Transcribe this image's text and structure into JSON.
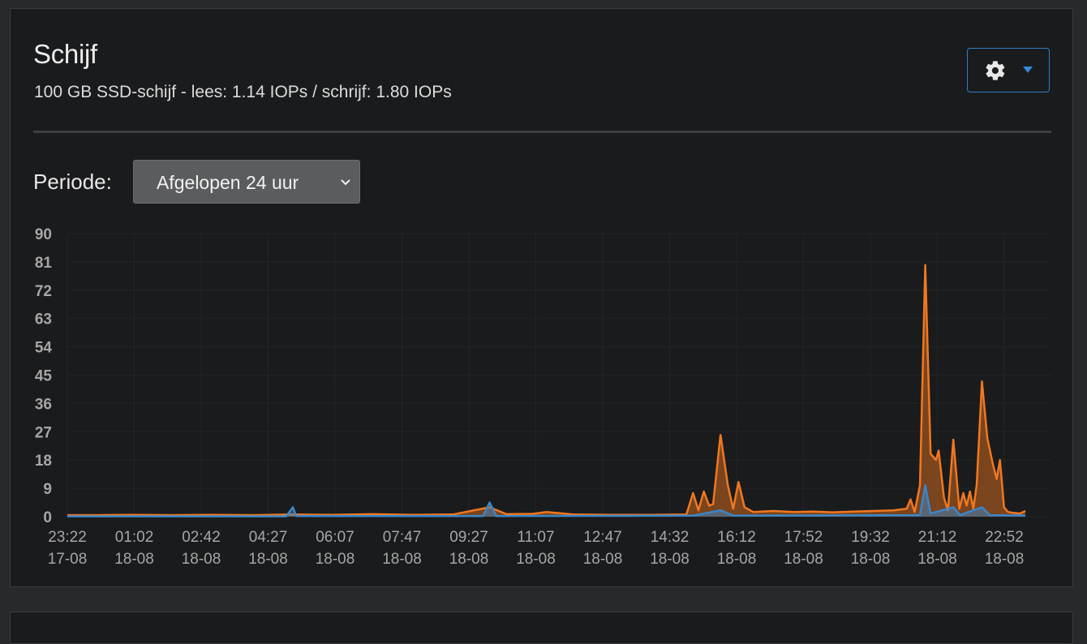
{
  "panel": {
    "title": "Schijf",
    "subtitle": "100 GB SSD-schijf - lees: 1.14 IOPs / schrijf: 1.80 IOPs",
    "settings_icon": "gear-icon",
    "dropdown_icon": "caret-down-icon"
  },
  "period": {
    "label": "Periode:",
    "selected": "Afgelopen 24 uur"
  },
  "colors": {
    "write": "#f07820",
    "read": "#3a86c8",
    "accent": "#2f7fc7"
  },
  "chart_data": {
    "type": "area",
    "title": "",
    "xlabel": "",
    "ylabel": "",
    "ylim": [
      0,
      90
    ],
    "yticks": [
      0,
      9,
      18,
      27,
      36,
      45,
      54,
      63,
      72,
      81,
      90
    ],
    "xticks": [
      {
        "time": "23:22",
        "date": "17-08"
      },
      {
        "time": "01:02",
        "date": "18-08"
      },
      {
        "time": "02:42",
        "date": "18-08"
      },
      {
        "time": "04:27",
        "date": "18-08"
      },
      {
        "time": "06:07",
        "date": "18-08"
      },
      {
        "time": "07:47",
        "date": "18-08"
      },
      {
        "time": "09:27",
        "date": "18-08"
      },
      {
        "time": "11:07",
        "date": "18-08"
      },
      {
        "time": "12:47",
        "date": "18-08"
      },
      {
        "time": "14:32",
        "date": "18-08"
      },
      {
        "time": "16:12",
        "date": "18-08"
      },
      {
        "time": "17:52",
        "date": "18-08"
      },
      {
        "time": "19:32",
        "date": "18-08"
      },
      {
        "time": "21:12",
        "date": "18-08"
      },
      {
        "time": "22:52",
        "date": "18-08"
      }
    ],
    "grid": true,
    "series": [
      {
        "color": "#f07820",
        "points": [
          [
            "17-08 23:22",
            0.5
          ],
          [
            "18-08 00:10",
            0.5
          ],
          [
            "18-08 01:00",
            0.6
          ],
          [
            "18-08 02:00",
            0.5
          ],
          [
            "18-08 03:00",
            0.6
          ],
          [
            "18-08 04:00",
            0.5
          ],
          [
            "18-08 05:00",
            0.7
          ],
          [
            "18-08 06:00",
            0.6
          ],
          [
            "18-08 07:00",
            0.8
          ],
          [
            "18-08 08:00",
            0.6
          ],
          [
            "18-08 09:00",
            0.7
          ],
          [
            "18-08 09:55",
            3.0
          ],
          [
            "18-08 10:20",
            0.8
          ],
          [
            "18-08 11:00",
            0.9
          ],
          [
            "18-08 11:20",
            1.5
          ],
          [
            "18-08 12:00",
            0.7
          ],
          [
            "18-08 13:00",
            0.6
          ],
          [
            "18-08 14:00",
            0.6
          ],
          [
            "18-08 14:50",
            0.7
          ],
          [
            "18-08 15:00",
            7.5
          ],
          [
            "18-08 15:08",
            2.0
          ],
          [
            "18-08 15:16",
            8.0
          ],
          [
            "18-08 15:24",
            3.5
          ],
          [
            "18-08 15:30",
            4.0
          ],
          [
            "18-08 15:41",
            26.0
          ],
          [
            "18-08 15:52",
            10.0
          ],
          [
            "18-08 16:00",
            2.5
          ],
          [
            "18-08 16:08",
            11.0
          ],
          [
            "18-08 16:17",
            3.0
          ],
          [
            "18-08 16:30",
            1.5
          ],
          [
            "18-08 17:00",
            1.8
          ],
          [
            "18-08 17:30",
            1.5
          ],
          [
            "18-08 18:00",
            1.6
          ],
          [
            "18-08 18:30",
            1.4
          ],
          [
            "18-08 19:00",
            1.6
          ],
          [
            "18-08 19:30",
            1.8
          ],
          [
            "18-08 20:00",
            2.0
          ],
          [
            "18-08 20:20",
            2.5
          ],
          [
            "18-08 20:26",
            5.5
          ],
          [
            "18-08 20:32",
            1.5
          ],
          [
            "18-08 20:40",
            10.0
          ],
          [
            "18-08 20:48",
            80.0
          ],
          [
            "18-08 20:56",
            20.0
          ],
          [
            "18-08 21:04",
            18.0
          ],
          [
            "18-08 21:08",
            21.0
          ],
          [
            "18-08 21:16",
            6.0
          ],
          [
            "18-08 21:22",
            2.0
          ],
          [
            "18-08 21:30",
            24.5
          ],
          [
            "18-08 21:39",
            2.5
          ],
          [
            "18-08 21:45",
            7.5
          ],
          [
            "18-08 21:50",
            3.5
          ],
          [
            "18-08 21:55",
            8.0
          ],
          [
            "18-08 22:00",
            2.5
          ],
          [
            "18-08 22:05",
            10.0
          ],
          [
            "18-08 22:13",
            43.0
          ],
          [
            "18-08 22:21",
            25.0
          ],
          [
            "18-08 22:29",
            17.0
          ],
          [
            "18-08 22:35",
            12.0
          ],
          [
            "18-08 22:40",
            18.0
          ],
          [
            "18-08 22:46",
            3.0
          ],
          [
            "18-08 22:52",
            1.5
          ],
          [
            "18-08 23:00",
            1.2
          ],
          [
            "18-08 23:10",
            1.0
          ],
          [
            "18-08 23:18",
            1.8
          ]
        ]
      },
      {
        "color": "#3a86c8",
        "points": [
          [
            "17-08 23:22",
            0.1
          ],
          [
            "18-08 04:50",
            0.1
          ],
          [
            "18-08 05:00",
            3.0
          ],
          [
            "18-08 05:05",
            0.2
          ],
          [
            "18-08 09:45",
            0.2
          ],
          [
            "18-08 09:55",
            4.5
          ],
          [
            "18-08 10:05",
            0.2
          ],
          [
            "18-08 15:00",
            0.3
          ],
          [
            "18-08 15:41",
            2.0
          ],
          [
            "18-08 16:00",
            0.3
          ],
          [
            "18-08 20:40",
            0.5
          ],
          [
            "18-08 20:48",
            10.0
          ],
          [
            "18-08 20:56",
            1.0
          ],
          [
            "18-08 21:30",
            3.0
          ],
          [
            "18-08 21:40",
            0.5
          ],
          [
            "18-08 22:13",
            3.0
          ],
          [
            "18-08 22:25",
            0.5
          ],
          [
            "18-08 23:18",
            0.3
          ]
        ]
      }
    ]
  }
}
